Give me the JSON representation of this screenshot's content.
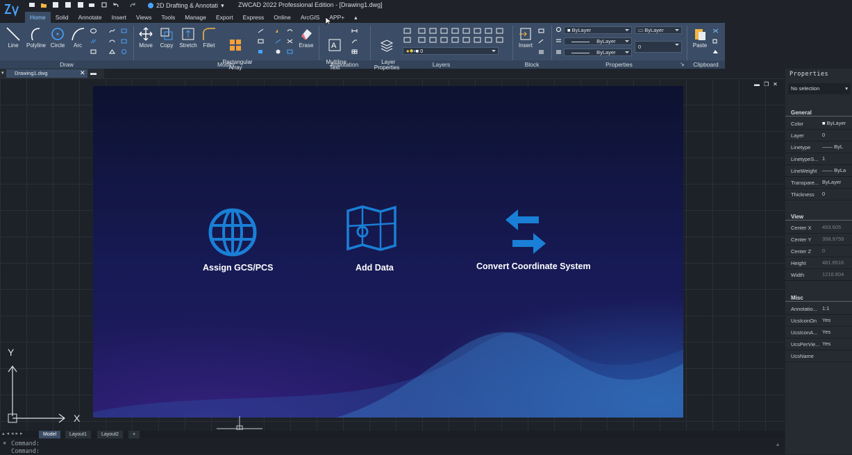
{
  "window": {
    "workspace": "2D Drafting & Annotati",
    "title": "ZWCAD 2022 Professional Edition - [Drawing1.dwg]"
  },
  "tabs": [
    "Home",
    "Solid",
    "Annotate",
    "Insert",
    "Views",
    "Tools",
    "Manage",
    "Export",
    "Express",
    "Online",
    "ArcGIS",
    "APP+"
  ],
  "draw": {
    "line": "Line",
    "polyline": "Polyline",
    "circle": "Circle",
    "arc": "Arc"
  },
  "modify": {
    "move": "Move",
    "copy": "Copy",
    "stretch": "Stretch",
    "fillet": "Fillet",
    "rect_array": "Rectangular\nArray",
    "erase": "Erase"
  },
  "annotation": {
    "mtext": "Multiline\nText"
  },
  "layers": {
    "layer_props": "Layer\nProperties",
    "current_layer": "0"
  },
  "block": {
    "insert": "Insert"
  },
  "properties": {
    "color": "ByLayer",
    "linetype": "ByLayer",
    "lineweight": "ByLayer",
    "plotstyle": "ByLayer",
    "transparency": "0"
  },
  "clipboard": {
    "paste": "Paste"
  },
  "panels": {
    "draw": "Draw",
    "modify": "Modify",
    "annotation": "Annotation",
    "layers": "Layers",
    "block": "Block",
    "properties": "Properties",
    "clipboard": "Clipboard"
  },
  "doc": {
    "tab": "Drawing1.dwg"
  },
  "viewport": {
    "assign": "Assign GCS/PCS",
    "add": "Add Data",
    "convert": "Convert Coordinate System"
  },
  "ucs": {
    "x": "X",
    "y": "Y"
  },
  "layout_tabs": [
    "Model",
    "Layout1",
    "Layout2",
    "+"
  ],
  "command": {
    "line1": "Command:",
    "line2": "Command:"
  },
  "palette": {
    "title": "Properties",
    "selection": "No selection",
    "general": "General",
    "view": "View",
    "misc": "Misc",
    "general_rows": [
      {
        "k": "Color",
        "v": "ByLayer"
      },
      {
        "k": "Layer",
        "v": "0"
      },
      {
        "k": "Linetype",
        "v": "—— ByL"
      },
      {
        "k": "LinetypeS...",
        "v": "1"
      },
      {
        "k": "LineWeight",
        "v": "—— ByLa"
      },
      {
        "k": "Transpare...",
        "v": "ByLayer"
      },
      {
        "k": "Thickness",
        "v": "0"
      }
    ],
    "view_rows": [
      {
        "k": "Center X",
        "v": "493.605"
      },
      {
        "k": "Center Y",
        "v": "398.9759"
      },
      {
        "k": "Center Z",
        "v": "0"
      },
      {
        "k": "Height",
        "v": "481.6516"
      },
      {
        "k": "Width",
        "v": "1216.804"
      }
    ],
    "misc_rows": [
      {
        "k": "Annotatio...",
        "v": "1:1"
      },
      {
        "k": "UcsIconOn",
        "v": "Yes"
      },
      {
        "k": "UcsIconA...",
        "v": "Yes"
      },
      {
        "k": "UcsPerVie...",
        "v": "Yes"
      },
      {
        "k": "UcsName",
        "v": ""
      }
    ]
  },
  "colors": {
    "accent": "#3b4d66",
    "active_tab_text": "#8ec5ff",
    "icon_blue": "#1a7fd6"
  }
}
